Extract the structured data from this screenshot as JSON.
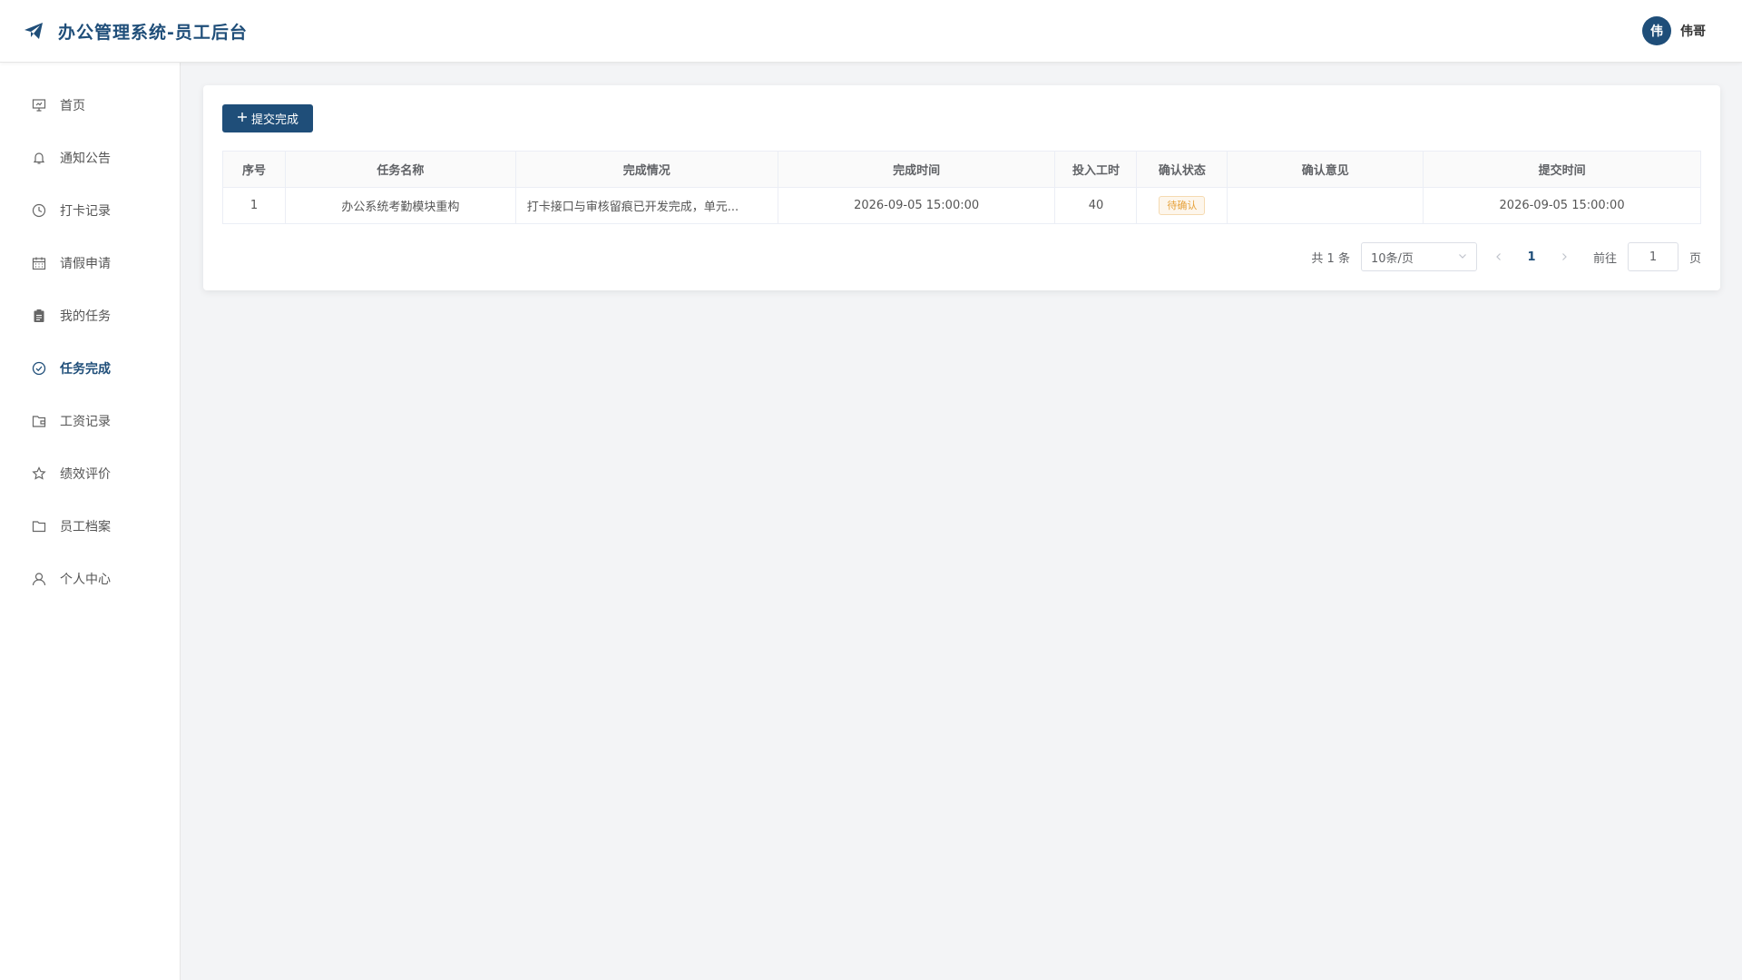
{
  "app": {
    "title": "办公管理系统-员工后台"
  },
  "user": {
    "avatar_text": "伟",
    "name": "伟哥"
  },
  "sidebar": {
    "items": [
      {
        "label": "首页",
        "icon": "presentation-icon",
        "active": false
      },
      {
        "label": "通知公告",
        "icon": "bell-icon",
        "active": false
      },
      {
        "label": "打卡记录",
        "icon": "clock-icon",
        "active": false
      },
      {
        "label": "请假申请",
        "icon": "calendar-icon",
        "active": false
      },
      {
        "label": "我的任务",
        "icon": "clipboard-icon",
        "active": false
      },
      {
        "label": "任务完成",
        "icon": "check-circle-icon",
        "active": true
      },
      {
        "label": "工资记录",
        "icon": "wallet-icon",
        "active": false
      },
      {
        "label": "绩效评价",
        "icon": "star-icon",
        "active": false
      },
      {
        "label": "员工档案",
        "icon": "folder-icon",
        "active": false
      },
      {
        "label": "个人中心",
        "icon": "user-icon",
        "active": false
      }
    ]
  },
  "toolbar": {
    "submit_label": "提交完成",
    "submit_icon": "plus-icon"
  },
  "table": {
    "headers": [
      "序号",
      "任务名称",
      "完成情况",
      "完成时间",
      "投入工时",
      "确认状态",
      "确认意见",
      "提交时间"
    ],
    "rows": [
      {
        "index": "1",
        "task_name": "办公系统考勤模块重构",
        "completion": "打卡接口与审核留痕已开发完成，单元...",
        "finish_time": "2026-09-05 15:00:00",
        "hours": "40",
        "status": "待确认",
        "opinion": "",
        "submit_time": "2026-09-05 15:00:00"
      }
    ]
  },
  "pagination": {
    "total_text": "共 1 条",
    "page_size": "10条/页",
    "current_page": "1",
    "goto_label": "前往",
    "goto_value": "1",
    "page_suffix": "页"
  },
  "colors": {
    "primary": "#1f4e79",
    "warning": "#e6a23c",
    "background": "#f3f4f6"
  }
}
